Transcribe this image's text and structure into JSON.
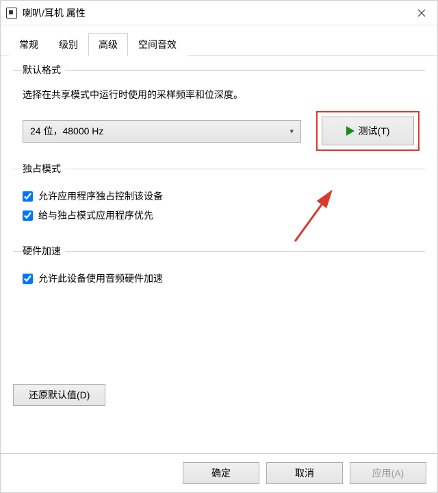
{
  "window": {
    "title": "喇叭/耳机 属性"
  },
  "tabs": [
    {
      "label": "常规",
      "active": false
    },
    {
      "label": "级别",
      "active": false
    },
    {
      "label": "高级",
      "active": true
    },
    {
      "label": "空间音效",
      "active": false
    }
  ],
  "default_format": {
    "legend": "默认格式",
    "desc": "选择在共享模式中运行时使用的采样频率和位深度。",
    "selected": "24 位，48000 Hz",
    "test_label": "测试(T)"
  },
  "exclusive": {
    "legend": "独占模式",
    "opt1": "允许应用程序独占控制该设备",
    "opt2": "给与独占模式应用程序优先"
  },
  "hw_accel": {
    "legend": "硬件加速",
    "opt1": "允许此设备使用音频硬件加速"
  },
  "restore_defaults": "还原默认值(D)",
  "footer": {
    "ok": "确定",
    "cancel": "取消",
    "apply": "应用(A)"
  }
}
